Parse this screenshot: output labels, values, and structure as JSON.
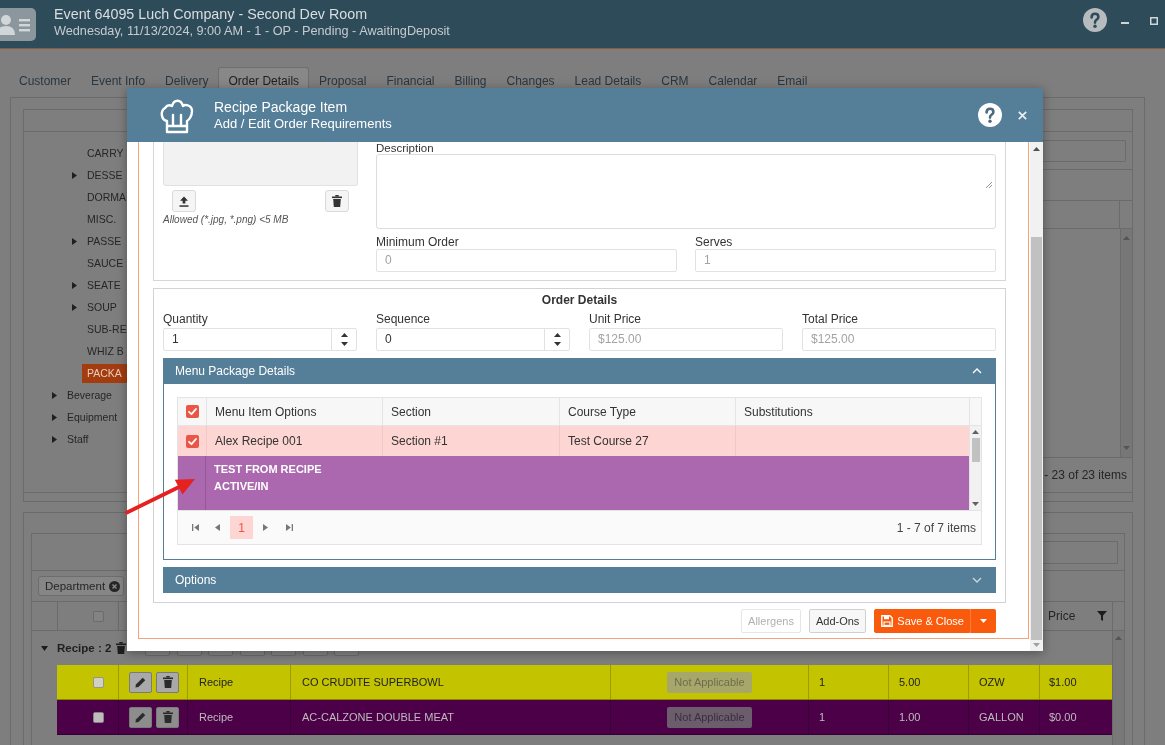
{
  "header": {
    "title": "Event 64095 Luch Company - Second Dev Room",
    "subtitle": "Wednesday, 11/13/2024, 9:00 AM - 1 - OP - Pending - AwaitingDeposit"
  },
  "tabs": [
    {
      "label": "Customer",
      "selected": false
    },
    {
      "label": "Event Info",
      "selected": false
    },
    {
      "label": "Delivery",
      "selected": false
    },
    {
      "label": "Order Details",
      "selected": true
    },
    {
      "label": "Proposal",
      "selected": false
    },
    {
      "label": "Financial",
      "selected": false
    },
    {
      "label": "Billing",
      "selected": false
    },
    {
      "label": "Changes",
      "selected": false
    },
    {
      "label": "Lead Details",
      "selected": false
    },
    {
      "label": "CRM",
      "selected": false
    },
    {
      "label": "Calendar",
      "selected": false
    },
    {
      "label": "Email",
      "selected": false
    }
  ],
  "tree": [
    {
      "children": [
        {
          "label": "CARRY",
          "kind": "leaf",
          "selected": false
        },
        {
          "label": "DESSE",
          "kind": "branch",
          "expanded": false,
          "selected": false
        },
        {
          "label": "DORMA",
          "kind": "leaf",
          "selected": false
        },
        {
          "label": "MISC.",
          "kind": "leaf",
          "selected": false
        },
        {
          "label": "PASSE",
          "kind": "branch",
          "expanded": false,
          "selected": false
        },
        {
          "label": "SAUCE",
          "kind": "leaf",
          "selected": false
        },
        {
          "label": "SEATE",
          "kind": "branch",
          "expanded": false,
          "selected": false
        },
        {
          "label": "SOUP",
          "kind": "branch",
          "expanded": false,
          "selected": false
        },
        {
          "label": "SUB-RE",
          "kind": "leaf",
          "selected": false
        },
        {
          "label": "WHIZ B",
          "kind": "leaf",
          "selected": false
        },
        {
          "label": "PACKA",
          "kind": "leaf",
          "selected": true
        }
      ]
    },
    {
      "label": "Beverage",
      "kind": "branch",
      "expanded": false,
      "selected": false
    },
    {
      "label": "Equipment",
      "kind": "branch",
      "expanded": false,
      "selected": false
    },
    {
      "label": "Staff",
      "kind": "branch",
      "expanded": false,
      "selected": false
    }
  ],
  "item_list": {
    "summary": "- 23 of 23 items"
  },
  "order_grid": {
    "filters": [
      {
        "label": "Department"
      }
    ],
    "header_checked": false,
    "last_column_header": "Price",
    "group": {
      "label": "Recipe : 2",
      "expanded": true
    },
    "rows": [
      {
        "color": "#c3c300",
        "checked": false,
        "cells": [
          "Recipe",
          "CO CRUDITE SUPERBOWL",
          "Not Applicable",
          "1",
          "5.00",
          "OZW",
          "$1.00"
        ]
      },
      {
        "color": "#4b0047",
        "checked": false,
        "cells": [
          "Recipe",
          "AC-CALZONE DOUBLE MEAT",
          "Not Applicable",
          "1",
          "1.00",
          "GALLON",
          "$0.00"
        ]
      }
    ]
  },
  "dialog": {
    "title": "Recipe Package Item",
    "subtitle": "Add / Edit Order Requirements",
    "image": {
      "hint": "Allowed (*.jpg, *.png) <5 MB"
    },
    "description": {
      "label": "Description"
    },
    "fields": [
      {
        "label": "Minimum Order",
        "value": "0",
        "disabled": true
      },
      {
        "label": "Serves",
        "value": "1",
        "disabled": true
      }
    ],
    "order_details": {
      "title": "Order Details",
      "fields": [
        {
          "label": "Quantity",
          "value": "1",
          "kind": "spinner",
          "disabled": false
        },
        {
          "label": "Sequence",
          "value": "0",
          "kind": "spinner",
          "disabled": false
        },
        {
          "label": "Unit Price",
          "value": "$125.00",
          "kind": "text",
          "disabled": true
        },
        {
          "label": "Total Price",
          "value": "$125.00",
          "kind": "text",
          "disabled": true
        }
      ]
    },
    "menu_package": {
      "title": "Menu Package Details",
      "expanded": true,
      "header_checked": true,
      "columns": [
        "Menu Item Options",
        "Section",
        "Course Type",
        "Substitutions"
      ],
      "rows": [
        {
          "kind": "item",
          "checked": true,
          "selected": true,
          "cells": [
            "Alex Recipe 001",
            "Section #1",
            "Test Course 27"
          ]
        },
        {
          "kind": "note",
          "selected": false,
          "color": "#ab68ae",
          "lines": [
            "TEST FROM RECIPE",
            "ACTIVE/IN"
          ]
        }
      ],
      "pages": [
        {
          "label": "1",
          "selected": true
        }
      ],
      "summary": "1 - 7 of 7 items"
    },
    "options": {
      "title": "Options",
      "expanded": false
    },
    "buttons": [
      {
        "label": "Allergens",
        "kind": "default",
        "disabled": true
      },
      {
        "label": "Add-Ons",
        "kind": "default",
        "disabled": false
      },
      {
        "label": "Save & Close",
        "kind": "primary",
        "disabled": false
      }
    ]
  }
}
